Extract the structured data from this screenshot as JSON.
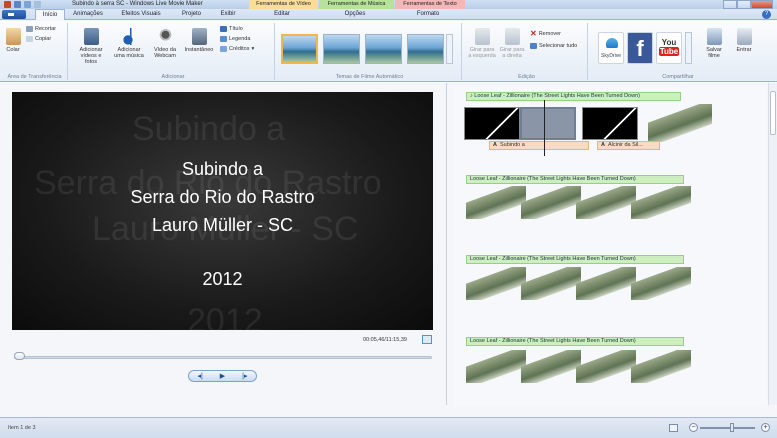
{
  "window": {
    "title": "Subindo à serra SC - Windows Live Movie Maker"
  },
  "context_tabs": {
    "video": "Ferramentas de Vídeo",
    "music": "Ferramentas de Música",
    "text": "Ferramentas de Texto"
  },
  "tabs": [
    "Início",
    "Animações",
    "Efeitos Visuais",
    "Projeto",
    "Exibir",
    "Editar",
    "Opções",
    "Formato"
  ],
  "active_tab": "Início",
  "ribbon": {
    "clipboard": {
      "paste": "Colar",
      "cut": "Recortar",
      "copy": "Copiar",
      "label": "Área de Transferência"
    },
    "add": {
      "add_videos_1": "Adicionar",
      "add_videos_2": "vídeos e fotos",
      "add_music_1": "Adicionar",
      "add_music_2": "uma música",
      "webcam_1": "Vídeo da",
      "webcam_2": "Webcam",
      "snapshot": "Instantâneo",
      "title": "Título",
      "caption": "Legenda",
      "credits": "Créditos",
      "label": "Adicionar"
    },
    "themes": {
      "label": "Temas de Filme Automático"
    },
    "editing": {
      "rotate_left_1": "Girar para",
      "rotate_left_2": "a esquerda",
      "rotate_right_1": "Girar para",
      "rotate_right_2": "a direita",
      "remove": "Remover",
      "select_all": "Selecionar tudo",
      "label": "Edição"
    },
    "share": {
      "skydrive": "SkyDrive",
      "youtube_you": "You",
      "youtube_tube": "Tube",
      "save_movie_1": "Salvar",
      "save_movie_2": "filme",
      "sign_in": "Entrar",
      "label": "Compartilhar"
    }
  },
  "preview": {
    "lines": [
      "Subindo a",
      "Serra do Rio do Rastro",
      "Lauro Müller - SC",
      "2012"
    ],
    "ghost_1": "Subindo a",
    "ghost_2": "Serra do Rio do Rastro",
    "ghost_3": "Lauro Müller - SC",
    "ghost_4": "2012",
    "timecode": "00:05,46/11:15,39"
  },
  "storyboard": {
    "music_first": "Loose Leaf - Zillionaire (The Street Lights Have Been Turned Down)",
    "music_track": "Loose Leaf - Zillionaire (The Street Lights Have Been Turned Down)",
    "caption_1": "Subindo a",
    "caption_2": "Alcinir da Sil..."
  },
  "status": {
    "item": "Item 1 de 3"
  },
  "colors": {
    "context_video": "#f7dc9a",
    "context_music": "#b7e29a",
    "context_text": "#f3b7b7",
    "music_bar": "#cdefc0",
    "caption_bar": "#f6dcc4"
  }
}
